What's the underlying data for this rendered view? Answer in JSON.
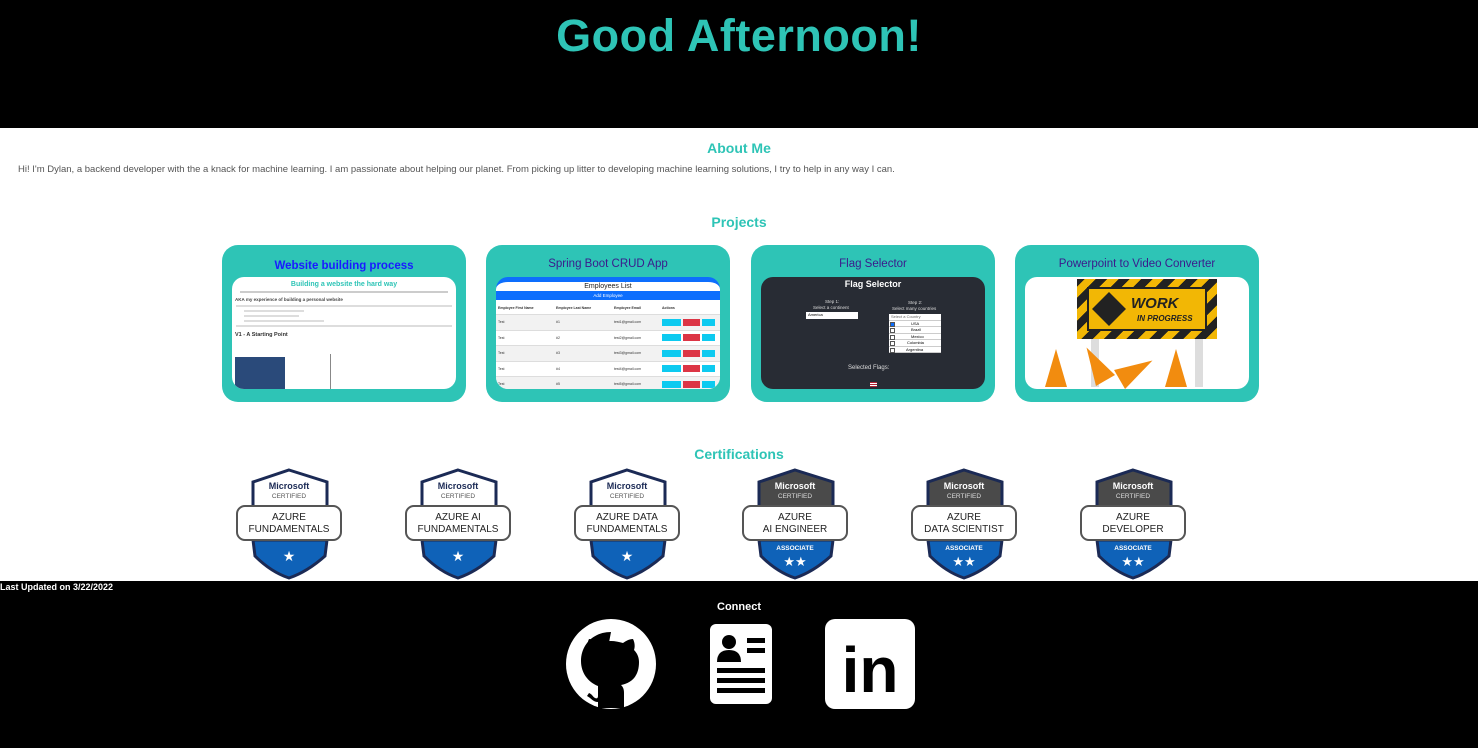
{
  "header": {
    "greeting": "Good Afternoon!"
  },
  "about": {
    "title": "About Me",
    "text": "Hi! I'm Dylan, a backend developer with the a knack for machine learning. I am passionate about helping our planet. From picking up litter to developing machine learning solutions, I try to help in any way I can."
  },
  "projects": {
    "title": "Projects",
    "items": [
      {
        "title": "Website building process",
        "preview": {
          "heading": "Building a website the hard way",
          "subheading": "AKA my experience of building a personal website",
          "section": "V1 - A Starting Point"
        }
      },
      {
        "title": "Spring Boot CRUD App",
        "preview": {
          "heading": "Employees List",
          "button": "Add Employee",
          "columns": [
            "Employee First Name",
            "Employee Last Name",
            "Employee Email",
            "Actions"
          ],
          "rows": [
            [
              "Test",
              "#1",
              "test1@gmail.com"
            ],
            [
              "Test",
              "#2",
              "test2@gmail.com"
            ],
            [
              "Test",
              "#3",
              "test3@gmail.com"
            ],
            [
              "Test",
              "#4",
              "test4@gmail.com"
            ],
            [
              "Test",
              "#5",
              "test5@gmail.com"
            ]
          ],
          "actions": [
            "Update",
            "Delete",
            "View"
          ]
        }
      },
      {
        "title": "Flag Selector",
        "preview": {
          "heading": "Flag Selector",
          "step1": "Step 1:",
          "step1_sub": "Select a continent",
          "continent_value": "America",
          "step2": "Step 2:",
          "step2_sub": "Select many countries",
          "list_header": "Select a Country",
          "countries": [
            "USA",
            "Brazil",
            "Mexico",
            "Colombia",
            "Argentina"
          ],
          "selected_label": "Selected Flags:"
        }
      },
      {
        "title": "Powerpoint to Video Converter",
        "preview": {
          "line1": "WORK",
          "line2": "IN PROGRESS"
        }
      }
    ]
  },
  "certifications": {
    "title": "Certifications",
    "badges": [
      {
        "brand": "Microsoft",
        "certified": "CERTIFIED",
        "line1": "AZURE",
        "line2": "FUNDAMENTALS",
        "level": "",
        "stars": 1
      },
      {
        "brand": "Microsoft",
        "certified": "CERTIFIED",
        "line1": "AZURE AI",
        "line2": "FUNDAMENTALS",
        "level": "",
        "stars": 1
      },
      {
        "brand": "Microsoft",
        "certified": "CERTIFIED",
        "line1": "AZURE DATA",
        "line2": "FUNDAMENTALS",
        "level": "",
        "stars": 1
      },
      {
        "brand": "Microsoft",
        "certified": "CERTIFIED",
        "line1": "AZURE",
        "line2": "AI ENGINEER",
        "level": "ASSOCIATE",
        "stars": 2
      },
      {
        "brand": "Microsoft",
        "certified": "CERTIFIED",
        "line1": "AZURE",
        "line2": "DATA SCIENTIST",
        "level": "ASSOCIATE",
        "stars": 2
      },
      {
        "brand": "Microsoft",
        "certified": "CERTIFIED",
        "line1": "AZURE",
        "line2": "DEVELOPER",
        "level": "ASSOCIATE",
        "stars": 2
      }
    ]
  },
  "footer": {
    "updated": "Last Updated on 3/22/2022",
    "connect": "Connect",
    "links": [
      {
        "icon": "github-icon"
      },
      {
        "icon": "resume-icon"
      },
      {
        "icon": "linkedin-icon",
        "text": "in"
      }
    ]
  },
  "colors": {
    "accent": "#2ec4b6",
    "background": "#000000",
    "badge_blue": "#0f62b8",
    "badge_dark": "#1b2a55"
  }
}
